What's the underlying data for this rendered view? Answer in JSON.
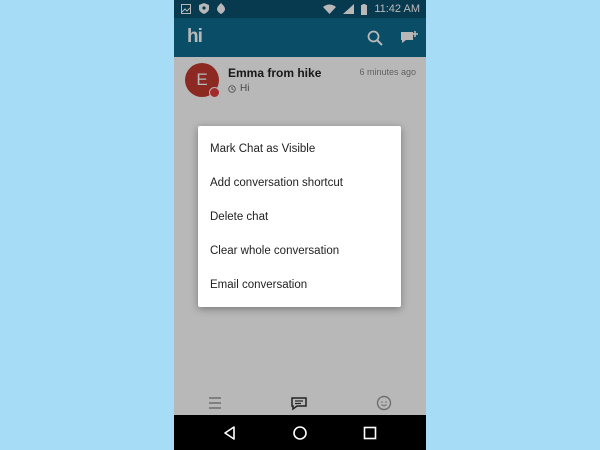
{
  "status_bar": {
    "time": "11:42 AM"
  },
  "app_bar": {
    "logo": "hi",
    "icons": [
      "search-icon",
      "new-chat-icon"
    ]
  },
  "chats": [
    {
      "initial": "E",
      "name": "Emma from hike",
      "time": "6 minutes ago",
      "preview": "Hi",
      "avatar_color": "#c23a30"
    }
  ],
  "context_menu": {
    "items": [
      "Mark Chat as Visible",
      "Add conversation shortcut",
      "Delete chat",
      "Clear whole conversation",
      "Email conversation"
    ]
  },
  "bottom_nav": {
    "icons": [
      "menu-icon",
      "chats-icon",
      "smiley-icon"
    ]
  },
  "system_nav": {
    "icons": [
      "back-icon",
      "home-icon",
      "recents-icon"
    ]
  },
  "colors": {
    "status_bar": "#0b4f6e",
    "app_bar": "#0d6b8f",
    "background": "#a6dcf6",
    "accent": "#0d6b8f"
  }
}
